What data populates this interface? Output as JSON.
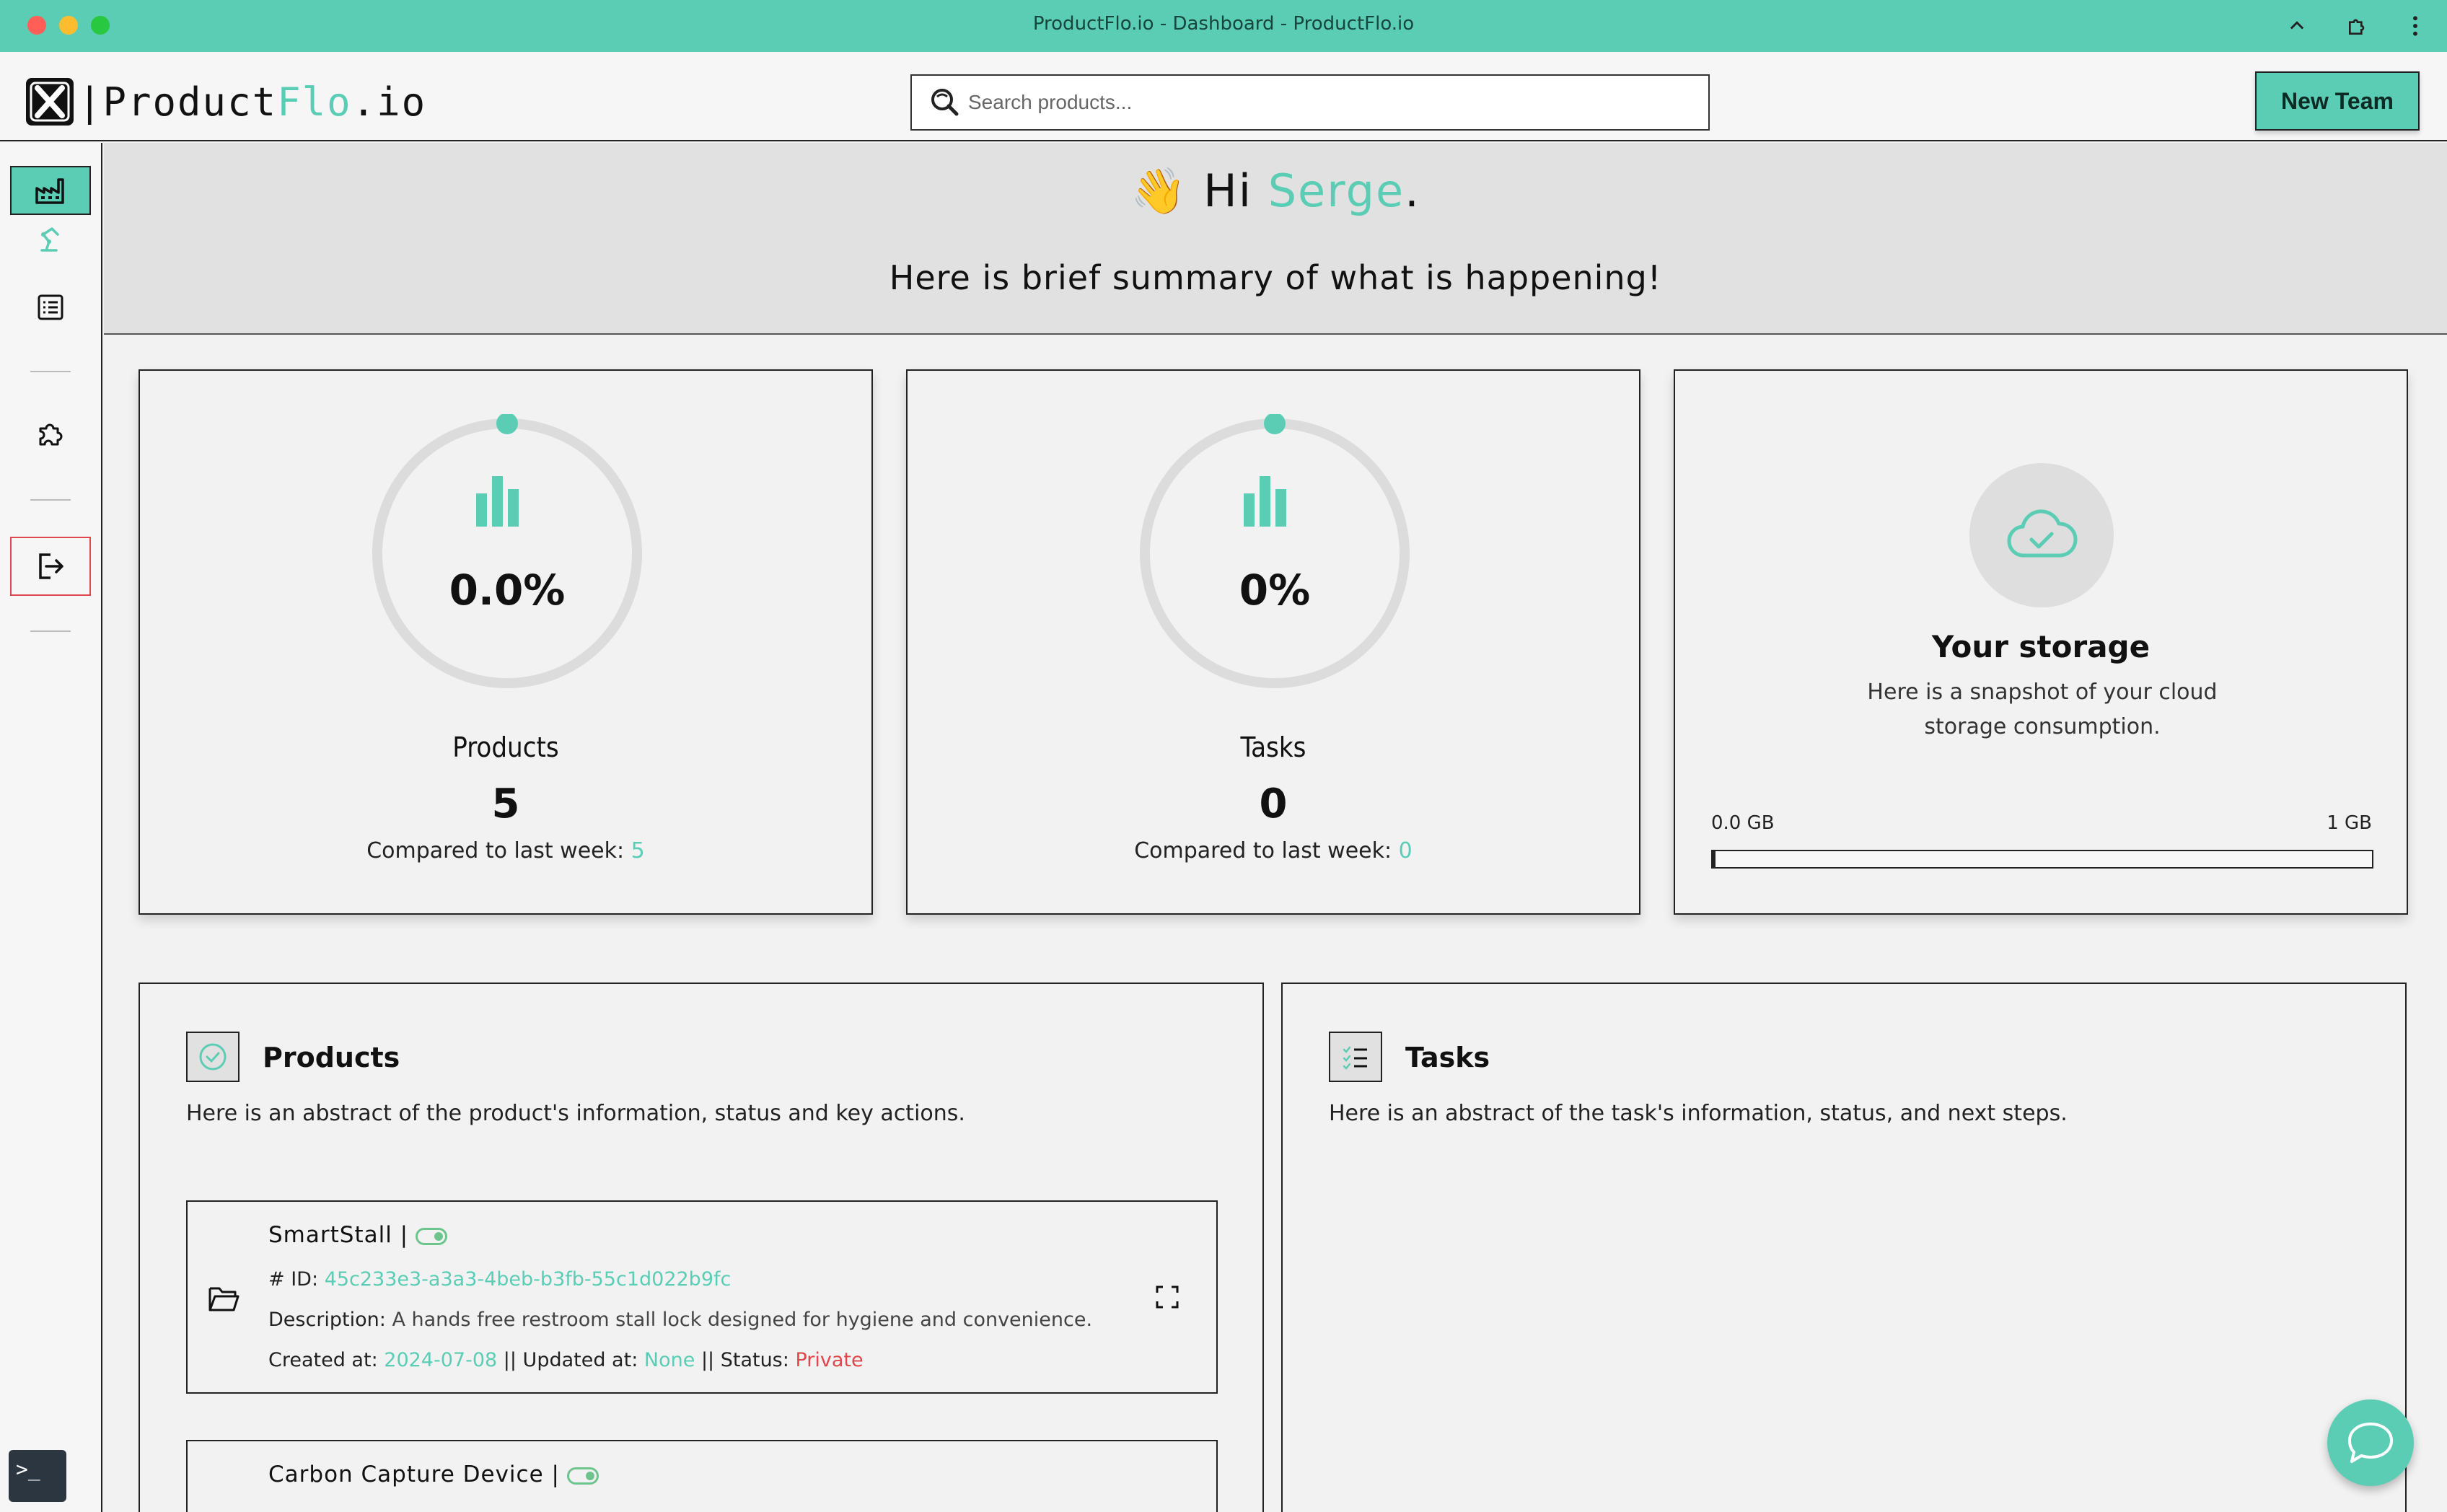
{
  "window": {
    "title": "ProductFlo.io - Dashboard - ProductFlo.io"
  },
  "header": {
    "logo_prefix": "|Product",
    "logo_flo": "Flo",
    "logo_suffix": ".io",
    "search_placeholder": "Search products...",
    "new_team_label": "New Team"
  },
  "greeting": {
    "hi": "Hi",
    "name": "Serge",
    "punct": ".",
    "summary": "Here is brief summary of what is happening!"
  },
  "stats": {
    "products": {
      "percent_label": "0.0%",
      "progress": 0.0,
      "label": "Products",
      "count": "5",
      "compare_label": "Compared to last week:",
      "compare_value": "5"
    },
    "tasks": {
      "percent_label": "0%",
      "progress": 0.0,
      "label": "Tasks",
      "count": "0",
      "compare_label": "Compared to last week:",
      "compare_value": "0"
    },
    "storage": {
      "title": "Your storage",
      "description": "Here is a snapshot of your cloud storage consumption.",
      "min_label": "0.0 GB",
      "max_label": "1 GB",
      "used_fraction": 0.0
    }
  },
  "products_panel": {
    "title": "Products",
    "description": "Here is an abstract of the product's information, status and key actions.",
    "items": [
      {
        "name": "SmartStall |",
        "id_label": "# ID:",
        "id": "45c233e3-a3a3-4beb-b3fb-55c1d022b9fc",
        "desc_label": "Description:",
        "description": "A hands free restroom stall lock designed for hygiene and convenience.",
        "created_label": "Created at:",
        "created": "2024-07-08",
        "updated_label": "|| Updated at:",
        "updated": "None",
        "status_label": "|| Status:",
        "status": "Private"
      },
      {
        "name": "Carbon Capture Device |"
      }
    ]
  },
  "tasks_panel": {
    "title": "Tasks",
    "description": "Here is an abstract of the task's information, status, and next steps."
  },
  "terminal": {
    "label": ">_"
  },
  "colors": {
    "accent": "#5ccdb5",
    "danger": "#e0474c",
    "toggle": "#6dc48c"
  },
  "icons": {
    "sidebar": [
      "factory-icon",
      "robot-arm-icon",
      "list-icon",
      "puzzle-icon",
      "logout-icon"
    ],
    "titlebar": [
      "chevron-up-icon",
      "extension-icon",
      "more-vertical-icon"
    ]
  }
}
